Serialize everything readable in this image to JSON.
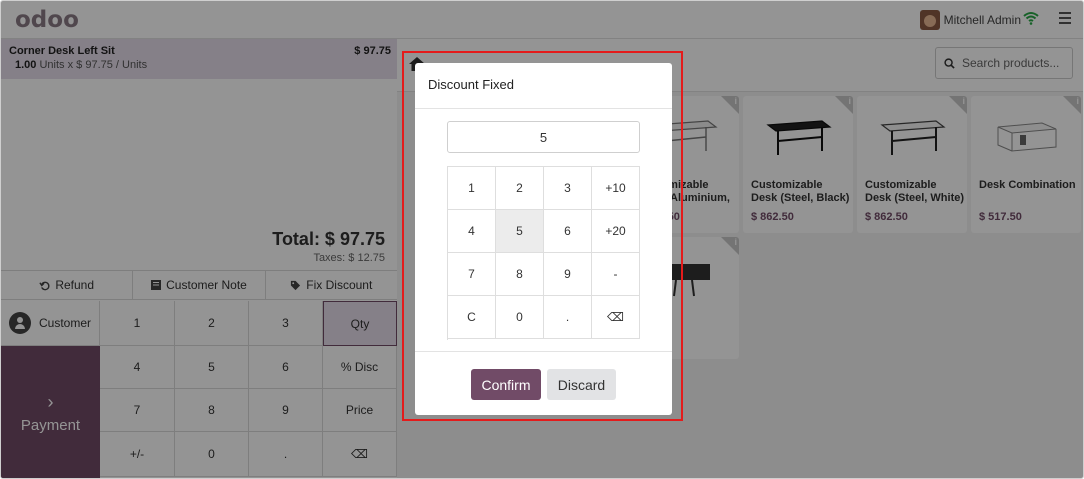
{
  "header": {
    "logo": "odoo",
    "user_name": "Mitchell Admin"
  },
  "order": {
    "line": {
      "product": "Corner Desk Left Sit",
      "price": "$ 97.75",
      "qty": "1.00",
      "detail": "Units x $ 97.75 / Units"
    },
    "total": "Total: $ 97.75",
    "taxes": "Taxes: $ 12.75"
  },
  "controls": {
    "refund": "Refund",
    "customer_note": "Customer Note",
    "fix_discount": "Fix Discount"
  },
  "pad": {
    "customer": "Customer",
    "payment": "Payment",
    "keys": [
      "1",
      "2",
      "3",
      "Qty",
      "4",
      "5",
      "6",
      "% Disc",
      "7",
      "8",
      "9",
      "Price",
      "+/-",
      "0",
      ".",
      "⌫"
    ]
  },
  "products": {
    "search_placeholder": "Search products...",
    "cards": [
      {
        "name": "Customizable Desk (Aluminium, White)",
        "price": "$ 862.50"
      },
      {
        "name": "Customizable Desk (Steel, Black)",
        "price": "$ 862.50"
      },
      {
        "name": "Customizable Desk (Steel, White)",
        "price": "$ 862.50"
      },
      {
        "name": "Desk Combination",
        "price": "$ 517.50"
      }
    ]
  },
  "dialog": {
    "title": "Discount Fixed",
    "value": "5",
    "keys": [
      "1",
      "2",
      "3",
      "+10",
      "4",
      "5",
      "6",
      "+20",
      "7",
      "8",
      "9",
      "-",
      "C",
      "0",
      ".",
      "⌫"
    ],
    "confirm": "Confirm",
    "discard": "Discard"
  },
  "colors": {
    "brand": "#714b67",
    "highlight": "#e41b1b"
  }
}
